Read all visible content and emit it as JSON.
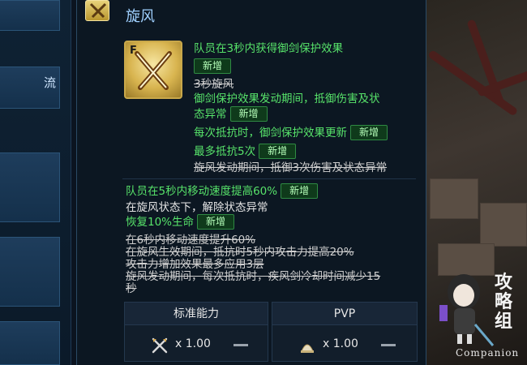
{
  "left_panel": {
    "tab_partial_label": "流"
  },
  "header": {
    "title": "旋风"
  },
  "skill": {
    "tier_letter": "F",
    "lines": [
      {
        "text": "队员在3秒内获得御剑保护效果",
        "style": "green"
      },
      {
        "text": "3秒旋风",
        "style": "strike"
      },
      {
        "text": "御剑保护效果发动期间，抵御伤害及状",
        "style": "green"
      },
      {
        "text": "态异常",
        "style": "green"
      },
      {
        "text": "每次抵抗时，御剑保护效果更新",
        "style": "green"
      },
      {
        "text": "最多抵抗5次",
        "style": "green"
      },
      {
        "text": "旋风发动期间，抵御3次伤害及状态异常",
        "style": "strike"
      },
      {
        "text": "队员在5秒内移动速度提高60%",
        "style": "green"
      },
      {
        "text": "在旋风状态下，解除状态异常",
        "style": "white"
      },
      {
        "text": "恢复10%生命",
        "style": "green"
      },
      {
        "text": "在6秒内移动速度提升60%",
        "style": "strike"
      },
      {
        "text": "在旋风生效期间，抵抗时5秒内攻击力提高20%",
        "style": "strike"
      },
      {
        "text": "攻击力增加效果最多应用3层",
        "style": "strike"
      },
      {
        "text": "旋风发动期间，每次抵抗时，疾风剑冷却时间减少15",
        "style": "strike"
      },
      {
        "text": "秒",
        "style": "strike"
      }
    ],
    "new_badge": "新增"
  },
  "stats": {
    "columns": [
      {
        "header": "标准能力",
        "icon": "crossed-swords-icon",
        "value": "x 1.00"
      },
      {
        "header": "PVP",
        "icon": "pvp-helmet-icon",
        "value": "x 1.00"
      }
    ]
  },
  "watermark": {
    "latin": "Companion",
    "chinese": "攻略组"
  },
  "colors": {
    "green_text": "#57e36a",
    "title_blue": "#9fd0ff",
    "badge_bg": "#0f3a1b",
    "badge_border": "#2f8a43"
  }
}
